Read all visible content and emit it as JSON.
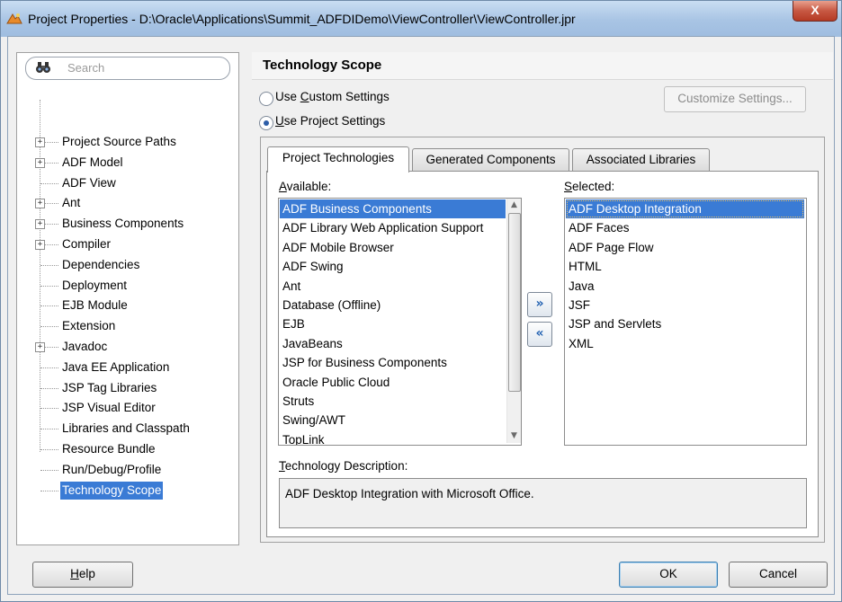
{
  "window": {
    "title": "Project Properties - D:\\Oracle\\Applications\\Summit_ADFDIDemo\\ViewController\\ViewController.jpr",
    "close_label": "X"
  },
  "sidebar": {
    "search_placeholder": "Search",
    "items": [
      {
        "label": "Project Source Paths",
        "expandable": true
      },
      {
        "label": "ADF Model",
        "expandable": true
      },
      {
        "label": "ADF View",
        "expandable": false
      },
      {
        "label": "Ant",
        "expandable": true
      },
      {
        "label": "Business Components",
        "expandable": true
      },
      {
        "label": "Compiler",
        "expandable": true
      },
      {
        "label": "Dependencies",
        "expandable": false
      },
      {
        "label": "Deployment",
        "expandable": false
      },
      {
        "label": "EJB Module",
        "expandable": false
      },
      {
        "label": "Extension",
        "expandable": false
      },
      {
        "label": "Javadoc",
        "expandable": true
      },
      {
        "label": "Java EE Application",
        "expandable": false
      },
      {
        "label": "JSP Tag Libraries",
        "expandable": false
      },
      {
        "label": "JSP Visual Editor",
        "expandable": false
      },
      {
        "label": "Libraries and Classpath",
        "expandable": false
      },
      {
        "label": "Resource Bundle",
        "expandable": false
      },
      {
        "label": "Run/Debug/Profile",
        "expandable": false
      },
      {
        "label": "Technology Scope",
        "expandable": false,
        "selected": true
      }
    ]
  },
  "main": {
    "heading": "Technology Scope",
    "radio_custom": {
      "label_pre": "Use ",
      "mnemonic": "C",
      "label_post": "ustom Settings",
      "checked": false
    },
    "radio_project": {
      "label_pre": "",
      "mnemonic": "U",
      "label_post": "se Project Settings",
      "checked": true
    },
    "customize_button": "Customize Settings...",
    "tabs": [
      {
        "label": "Project Technologies",
        "active": true
      },
      {
        "label": "Generated Components",
        "active": false
      },
      {
        "label": "Associated Libraries",
        "active": false
      }
    ],
    "available_label_m": "A",
    "available_label_rest": "vailable:",
    "selected_label_m": "S",
    "selected_label_rest": "elected:",
    "available": [
      "ADF Business Components",
      "ADF Library Web Application Support",
      "ADF Mobile Browser",
      "ADF Swing",
      "Ant",
      "Database (Offline)",
      "EJB",
      "JavaBeans",
      "JSP for Business Components",
      "Oracle Public Cloud",
      "Struts",
      "Swing/AWT",
      "TopLink"
    ],
    "selected": [
      "ADF Desktop Integration",
      "ADF Faces",
      "ADF Page Flow",
      "HTML",
      "Java",
      "JSF",
      "JSP and Servlets",
      "XML"
    ],
    "move_right": "»",
    "move_left": "«",
    "description_label_m": "T",
    "description_label_rest": "echnology Description:",
    "description": "ADF Desktop Integration with Microsoft Office."
  },
  "footer": {
    "help_m": "H",
    "help_rest": "elp",
    "ok": "OK",
    "cancel": "Cancel"
  },
  "colors": {
    "selection": "#3a7bd5",
    "titlebar": "#a8c4e4",
    "close": "#c75843"
  }
}
